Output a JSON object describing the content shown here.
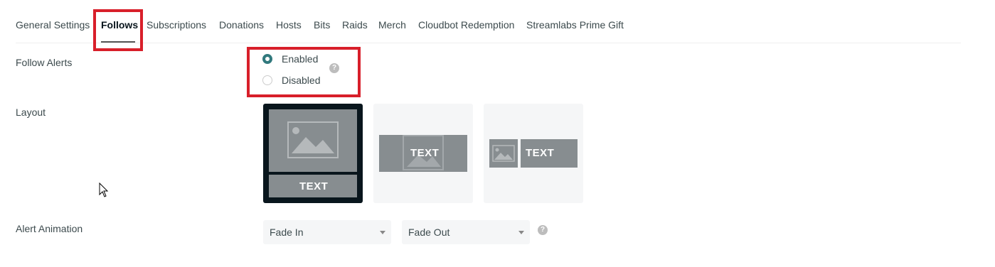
{
  "tabs": [
    {
      "label": "General Settings"
    },
    {
      "label": "Follows"
    },
    {
      "label": "Subscriptions"
    },
    {
      "label": "Donations"
    },
    {
      "label": "Hosts"
    },
    {
      "label": "Bits"
    },
    {
      "label": "Raids"
    },
    {
      "label": "Merch"
    },
    {
      "label": "Cloudbot Redemption"
    },
    {
      "label": "Streamlabs Prime Gift"
    }
  ],
  "active_tab": "Follows",
  "follow_alerts": {
    "label": "Follow Alerts",
    "options": [
      "Enabled",
      "Disabled"
    ],
    "selected": "Enabled",
    "help": "?"
  },
  "layout": {
    "label": "Layout",
    "cards": [
      {
        "text": "TEXT",
        "selected": true
      },
      {
        "text": "TEXT",
        "selected": false
      },
      {
        "text": "TEXT",
        "selected": false
      }
    ]
  },
  "alert_animation": {
    "label": "Alert Animation",
    "in": "Fade In",
    "out": "Fade Out",
    "help": "?"
  },
  "colors": {
    "highlight_box": "#d81f2a",
    "radio_checked": "#31797d",
    "card_selected": "#09161d",
    "card_gray": "#878d90"
  }
}
